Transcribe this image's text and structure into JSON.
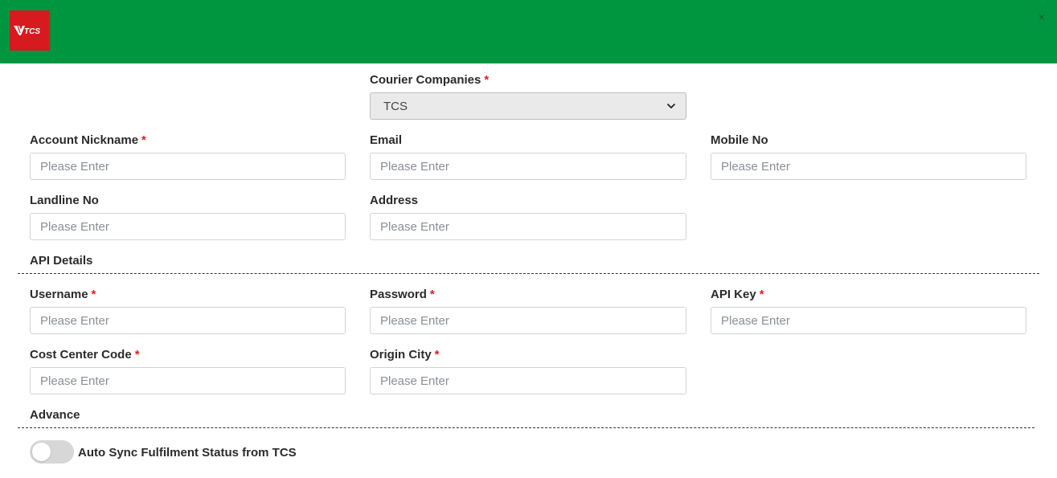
{
  "header": {
    "logo_text": "TCS",
    "close_glyph": "×",
    "background_color": "#009640",
    "logo_color": "#d61a1f"
  },
  "courier": {
    "label": "Courier Companies",
    "required": "*",
    "selected": "TCS",
    "chevron_icon": "chevron-down-icon"
  },
  "fields": {
    "account_nickname": {
      "label": "Account Nickname",
      "required": "*",
      "placeholder": "Please Enter",
      "value": ""
    },
    "email": {
      "label": "Email",
      "placeholder": "Please Enter",
      "value": ""
    },
    "mobile_no": {
      "label": "Mobile No",
      "placeholder": "Please Enter",
      "value": ""
    },
    "landline_no": {
      "label": "Landline No",
      "placeholder": "Please Enter",
      "value": ""
    },
    "address": {
      "label": "Address",
      "placeholder": "Please Enter",
      "value": ""
    }
  },
  "api_section": {
    "title": "API Details",
    "username": {
      "label": "Username",
      "required": "*",
      "placeholder": "Please Enter",
      "value": ""
    },
    "password": {
      "label": "Password",
      "required": "*",
      "placeholder": "Please Enter",
      "value": ""
    },
    "api_key": {
      "label": "API Key",
      "required": "*",
      "placeholder": "Please Enter",
      "value": ""
    },
    "cost_center_code": {
      "label": "Cost Center Code",
      "required": "*",
      "placeholder": "Please Enter",
      "value": ""
    },
    "origin_city": {
      "label": "Origin City",
      "required": "*",
      "placeholder": "Please Enter",
      "value": ""
    }
  },
  "advance_section": {
    "title": "Advance",
    "auto_sync": {
      "label": "Auto Sync Fulfilment Status from TCS",
      "enabled": false
    }
  }
}
